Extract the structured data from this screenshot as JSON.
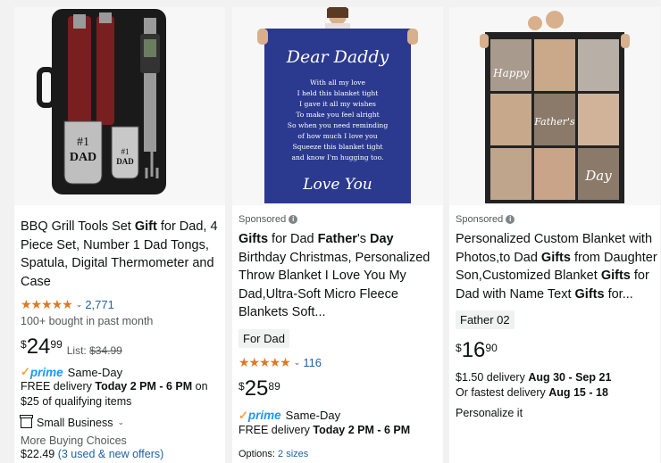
{
  "products": [
    {
      "title_parts": [
        {
          "text": "BBQ Grill Tools Set ",
          "bold": false
        },
        {
          "text": "Gift",
          "bold": true
        },
        {
          "text": " for Dad, 4 Piece Set, Number 1 Dad Tongs, Spatula, Digital Thermometer and Case",
          "bold": false
        }
      ],
      "rating_stars": "★★★★★",
      "rating_value": 4.7,
      "rating_count": "2,771",
      "bought": "100+ bought in past month",
      "price_symbol": "$",
      "price_whole": "24",
      "price_fraction": "99",
      "list_label": "List:",
      "list_price": "$34.99",
      "prime_word": "prime",
      "prime_speed": "Same-Day",
      "delivery_prefix": "FREE delivery ",
      "delivery_bold": "Today 2 PM - 6 PM",
      "delivery_suffix": " on $25 of qualifying items",
      "small_business": "Small Business",
      "more_choices": "More Buying Choices",
      "more_price": "$22.49",
      "more_offers": "(3 used & new offers)",
      "image_text": {
        "badge1": "#1",
        "badge2": "DAD",
        "badge3": "#1",
        "badge4": "DAD"
      }
    },
    {
      "sponsored": "Sponsored",
      "title_parts": [
        {
          "text": "Gifts",
          "bold": true
        },
        {
          "text": " for Dad ",
          "bold": false
        },
        {
          "text": "Father",
          "bold": true
        },
        {
          "text": "'s ",
          "bold": false
        },
        {
          "text": "Day",
          "bold": true
        },
        {
          "text": " Birthday Christmas, Personalized Throw Blanket I Love You My Dad,Ultra-Soft Micro Fleece Blankets Soft...",
          "bold": false
        }
      ],
      "tag": "For Dad",
      "rating_stars": "★★★★★",
      "rating_value": 4.8,
      "rating_count": "116",
      "price_symbol": "$",
      "price_whole": "25",
      "price_fraction": "89",
      "prime_word": "prime",
      "prime_speed": "Same-Day",
      "delivery_prefix": "FREE delivery ",
      "delivery_bold": "Today 2 PM - 6 PM",
      "options_label": "Options:",
      "options_link": "2 sizes",
      "image_text": {
        "heading": "Dear Daddy",
        "lines": [
          "With all my love",
          "I held this blanket tight",
          "I gave it all my wishes",
          "To make you feel alright",
          "So when you need reminding",
          "of how much I love you",
          "Squeeze this blanket tight",
          "and know I'm hugging too."
        ],
        "closing": "Love You"
      }
    },
    {
      "sponsored": "Sponsored",
      "title_parts": [
        {
          "text": "Personalized Custom Blanket with Photos,to Dad ",
          "bold": false
        },
        {
          "text": "Gifts",
          "bold": true
        },
        {
          "text": " from Daughter Son,Customized Blanket ",
          "bold": false
        },
        {
          "text": "Gifts",
          "bold": true
        },
        {
          "text": " for Dad with Name Text ",
          "bold": false
        },
        {
          "text": "Gifts",
          "bold": true
        },
        {
          "text": " for...",
          "bold": false
        }
      ],
      "tag": "Father 02",
      "price_symbol": "$",
      "price_whole": "16",
      "price_fraction": "90",
      "delivery_fee": "$1.50 delivery ",
      "delivery_dates": "Aug 30 - Sep 21",
      "fastest_prefix": "Or fastest delivery ",
      "fastest_dates": "Aug 15 - 18",
      "personalize": "Personalize it",
      "image_text": {
        "happy": "Happy",
        "fathers": "Father's",
        "day": "Day"
      }
    }
  ],
  "colors": {
    "star": "#de7921",
    "link": "#2162a1",
    "prime": "#1a98ff",
    "prime_check": "#f0a33e",
    "blanket_blue": "#2b3a8f"
  }
}
